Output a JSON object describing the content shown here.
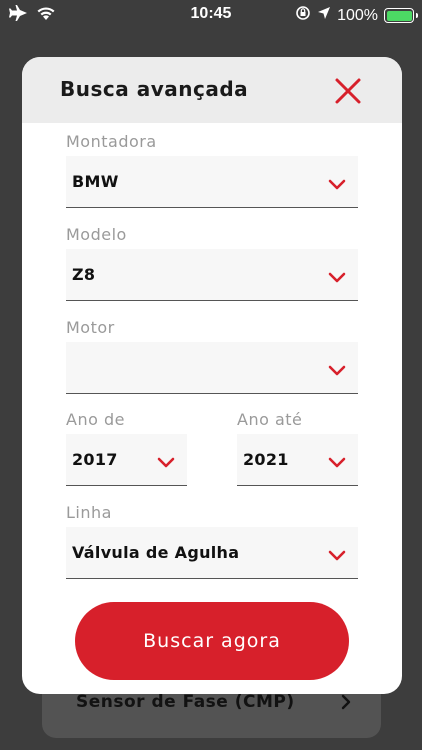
{
  "status_bar": {
    "time": "10:45",
    "battery": "100%",
    "battery_color": "#4cd964"
  },
  "background": {
    "card_label": "Sensor de Fase (CMP)"
  },
  "modal": {
    "title": "Busca avançada",
    "close_icon": "close-x-icon",
    "accent_color": "#d7202b",
    "fields": {
      "montadora": {
        "label": "Montadora",
        "value": "BMW"
      },
      "modelo": {
        "label": "Modelo",
        "value": "Z8"
      },
      "motor": {
        "label": "Motor",
        "value": ""
      },
      "ano_de": {
        "label": "Ano de",
        "value": "2017"
      },
      "ano_ate": {
        "label": "Ano até",
        "value": "2021"
      },
      "linha": {
        "label": "Linha",
        "value": "Válvula de Agulha"
      }
    },
    "submit_label": "Buscar agora"
  }
}
